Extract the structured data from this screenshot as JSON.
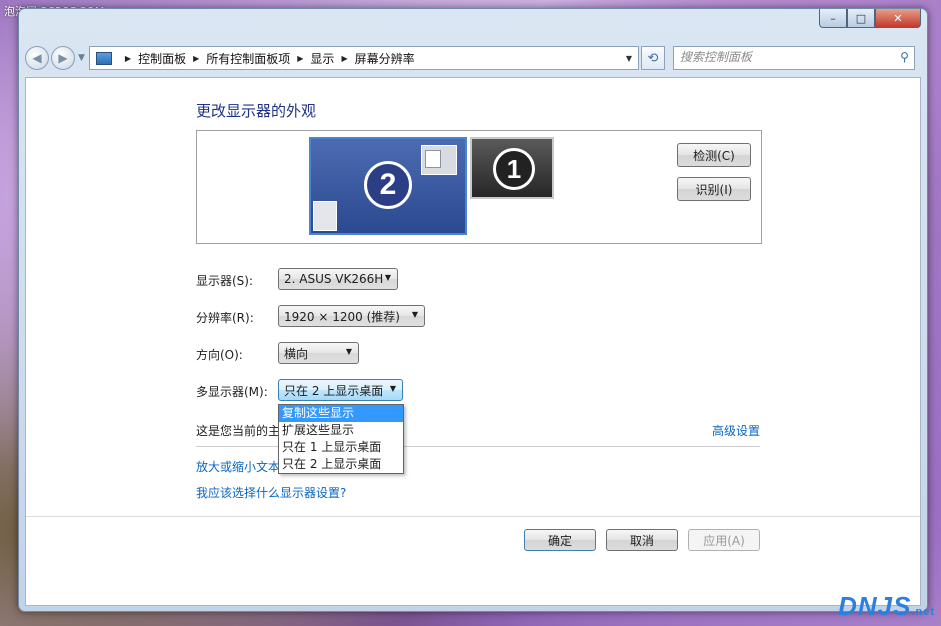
{
  "watermark": {
    "site": "泡泡网 PCPOP.COM",
    "logo": "DNJS",
    "logo_suffix": ".net"
  },
  "window": {
    "caption": {
      "minimize": "–",
      "maximize": "□",
      "close": "✕"
    }
  },
  "navbar": {
    "back_glyph": "◀",
    "forward_glyph": "▶",
    "breadcrumbs": [
      "控制面板",
      "所有控制面板项",
      "显示",
      "屏幕分辨率"
    ],
    "search_placeholder": "搜索控制面板"
  },
  "main": {
    "title": "更改显示器的外观",
    "monitors": [
      {
        "number": "2",
        "selected": true
      },
      {
        "number": "1",
        "selected": false
      }
    ],
    "detect_button": "检测(C)",
    "identify_button": "识别(I)",
    "display": {
      "label": "显示器(S):",
      "value": "2. ASUS VK266H"
    },
    "resolution": {
      "label": "分辨率(R):",
      "value": "1920 × 1200 (推荐)"
    },
    "orientation": {
      "label": "方向(O):",
      "value": "横向"
    },
    "multi_display": {
      "label": "多显示器(M):",
      "value": "只在 2 上显示桌面",
      "options": [
        "复制这些显示",
        "扩展这些显示",
        "只在 1 上显示桌面",
        "只在 2 上显示桌面"
      ],
      "highlighted": "复制这些显示"
    },
    "primary_text": "这是您当前的主",
    "advanced_link": "高级设置",
    "text_size_link": "放大或缩小文本",
    "help_link": "我应该选择什么显示器设置?"
  },
  "footer": {
    "ok": "确定",
    "cancel": "取消",
    "apply": "应用(A)"
  },
  "colors": {
    "title_blue": "#1e3287",
    "link_blue": "#0b66c2",
    "highlight": "#3399ff"
  }
}
